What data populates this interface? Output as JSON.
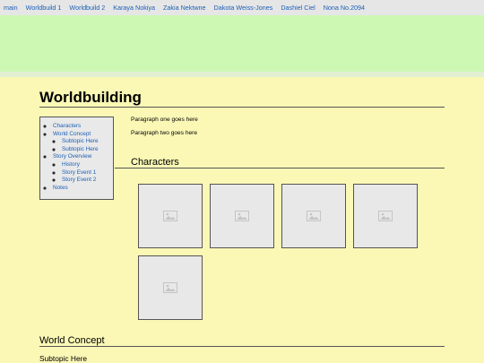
{
  "nav": {
    "tabs": [
      "main",
      "Worldbuild 1",
      "Worldbuild 2",
      "Karaya Nokiya",
      "Zakia Nektwne",
      "Dakota Weiss-Jones",
      "Dashiel Ciel",
      "Nona No.2094"
    ]
  },
  "page": {
    "title": "Worldbuilding"
  },
  "toc": {
    "characters": "Characters",
    "world_concept": "World Concept",
    "subtopic_1": "Subtopic Here",
    "subtopic_2": "Subtopic Here",
    "story_overview": "Story Overview",
    "history": "History",
    "story_event_1": "Story Event 1",
    "story_event_2": "Story Event 2",
    "notes": "Notes"
  },
  "content": {
    "paragraph_1": "Paragraph one goes here",
    "paragraph_2": "Paragraph two goes here",
    "characters_heading": "Characters",
    "world_concept_heading": "World Concept",
    "subtopic_heading": "Subtopic Here"
  },
  "images": {
    "icon": "image-placeholder-icon",
    "count": 5
  },
  "colors": {
    "background": "#fbf8b6",
    "banner": "#cdf8b4",
    "nav_bar": "#e6e6e6",
    "link": "#1c5fb6",
    "toc_background": "#e9e9e9"
  }
}
